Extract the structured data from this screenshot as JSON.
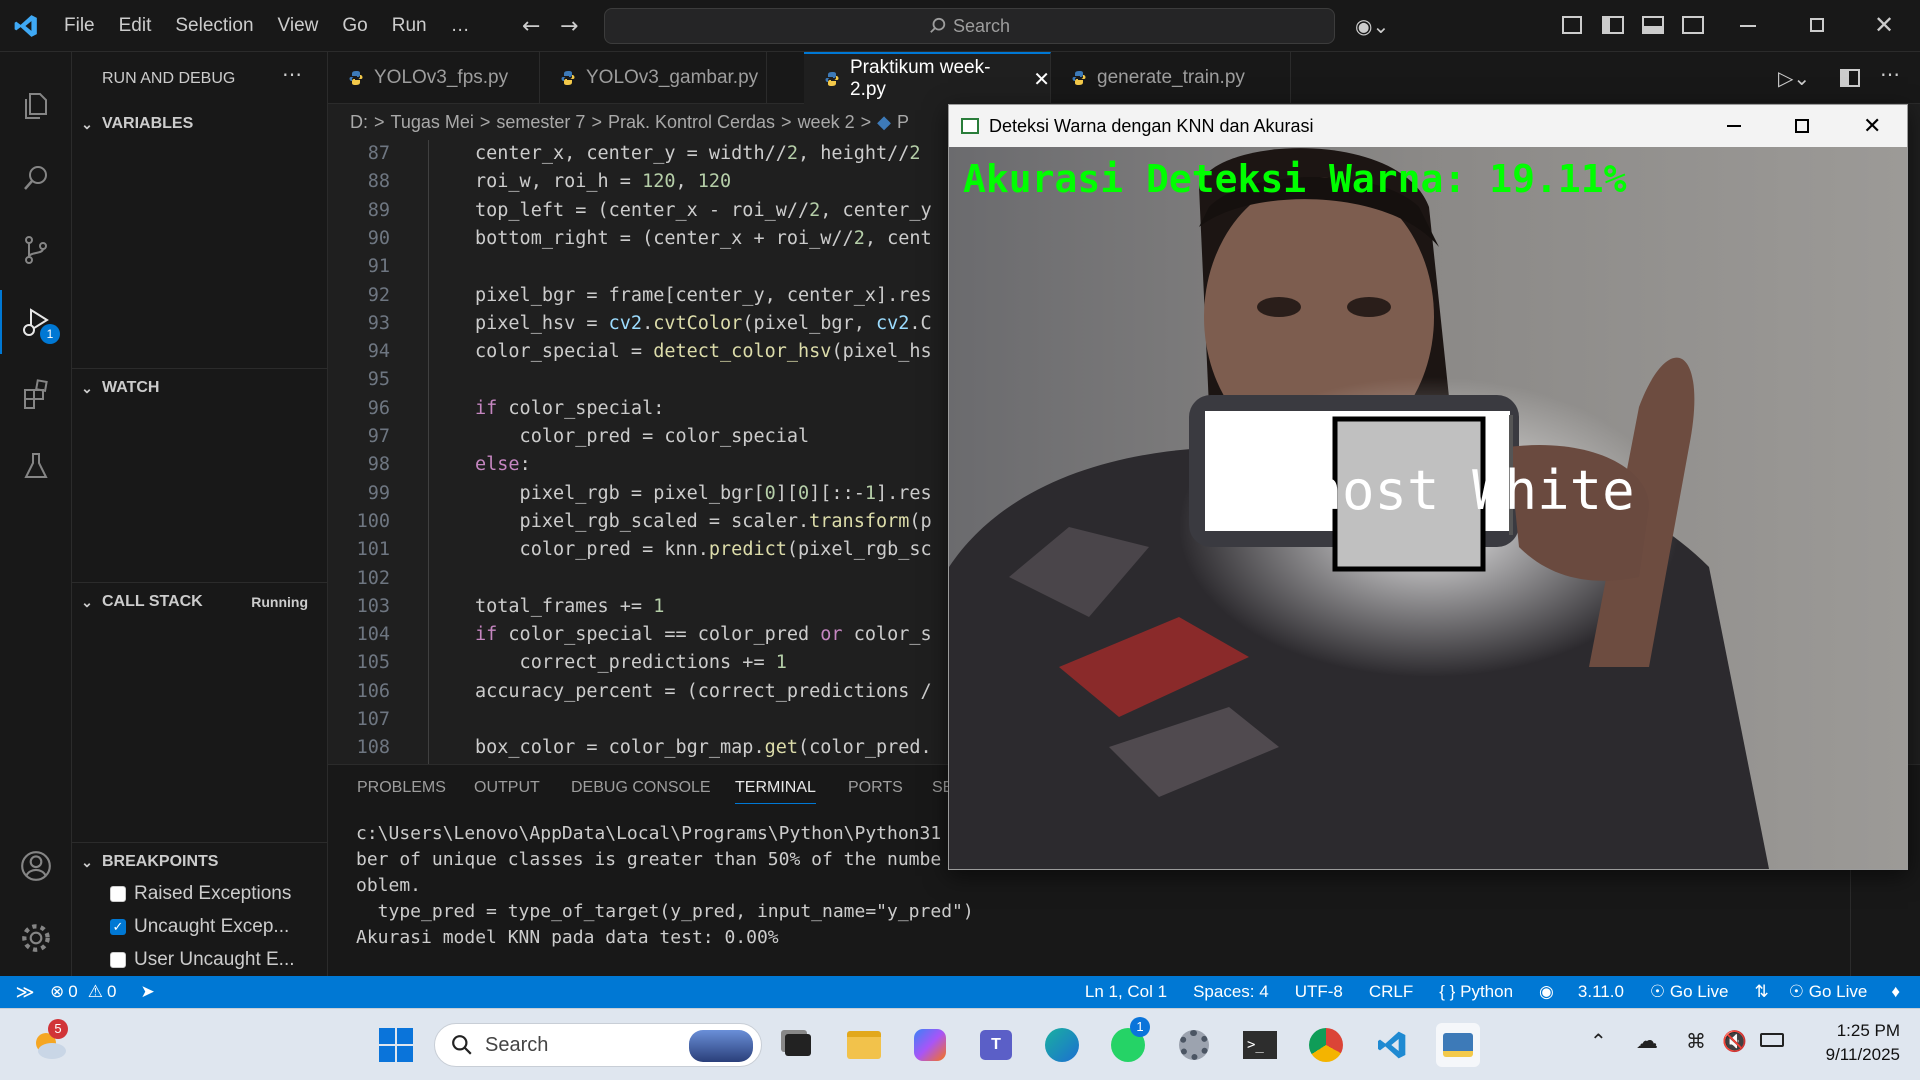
{
  "menu": [
    "File",
    "Edit",
    "Selection",
    "View",
    "Go",
    "Run",
    "…"
  ],
  "search": {
    "label": "Search"
  },
  "sidebar": {
    "title": "RUN AND DEBUG",
    "variables": "VARIABLES",
    "watch": "WATCH",
    "call_stack": "CALL STACK",
    "call_stack_status": "Running",
    "breakpoints": "BREAKPOINTS",
    "bp_items": [
      {
        "label": "Raised Exceptions",
        "checked": false
      },
      {
        "label": "Uncaught Excep...",
        "checked": true
      },
      {
        "label": "User Uncaught E...",
        "checked": false
      }
    ]
  },
  "activity": {
    "debug_badge": "1"
  },
  "tabs": [
    {
      "label": "YOLOv3_fps.py",
      "active": false
    },
    {
      "label": "YOLOv3_gambar.py",
      "active": false
    },
    {
      "label": "Praktikum week-2.py",
      "active": true
    },
    {
      "label": "generate_train.py",
      "active": false
    }
  ],
  "breadcrumb": [
    "D:",
    "Tugas Mei",
    "semester 7",
    "Prak. Kontrol Cerdas",
    "week 2",
    "P"
  ],
  "code": [
    {
      "n": "87",
      "t": "center_x, center_y = width//2, height//2"
    },
    {
      "n": "88",
      "t": "roi_w, roi_h = 120, 120"
    },
    {
      "n": "89",
      "t": "top_left = (center_x - roi_w//2, center_y"
    },
    {
      "n": "90",
      "t": "bottom_right = (center_x + roi_w//2, cent"
    },
    {
      "n": "91",
      "t": ""
    },
    {
      "n": "92",
      "t": "pixel_bgr = frame[center_y, center_x].res"
    },
    {
      "n": "93",
      "t": "pixel_hsv = cv2.cvtColor(pixel_bgr, cv2.C"
    },
    {
      "n": "94",
      "t": "color_special = detect_color_hsv(pixel_hs"
    },
    {
      "n": "95",
      "t": ""
    },
    {
      "n": "96",
      "t": "if color_special:"
    },
    {
      "n": "97",
      "t": "    color_pred = color_special"
    },
    {
      "n": "98",
      "t": "else:"
    },
    {
      "n": "99",
      "t": "    pixel_rgb = pixel_bgr[0][0][::-1].res"
    },
    {
      "n": "100",
      "t": "    pixel_rgb_scaled = scaler.transform(p"
    },
    {
      "n": "101",
      "t": "    color_pred = knn.predict(pixel_rgb_sc"
    },
    {
      "n": "102",
      "t": ""
    },
    {
      "n": "103",
      "t": "total_frames += 1"
    },
    {
      "n": "104",
      "t": "if color_special == color_pred or color_s"
    },
    {
      "n": "105",
      "t": "    correct_predictions += 1"
    },
    {
      "n": "106",
      "t": "accuracy_percent = (correct_predictions /"
    },
    {
      "n": "107",
      "t": ""
    },
    {
      "n": "108",
      "t": "box_color = color_bgr_map.get(color_pred."
    }
  ],
  "panel": {
    "tabs": [
      "PROBLEMS",
      "OUTPUT",
      "DEBUG CONSOLE",
      "TERMINAL",
      "PORTS",
      "SE"
    ],
    "terminal": [
      "c:\\Users\\Lenovo\\AppData\\Local\\Programs\\Python\\Python31",
      "ber of unique classes is greater than 50% of the numbe",
      "oblem.",
      "  type_pred = type_of_target(y_pred, input_name=\"y_pred\")",
      "Akurasi model KNN pada data test: 0.00%"
    ]
  },
  "status": {
    "errors": "0",
    "warnings": "0",
    "position": "Ln 1, Col 1",
    "spaces": "Spaces: 4",
    "encoding": "UTF-8",
    "eol": "CRLF",
    "language": "Python",
    "python_version": "3.11.0",
    "go_live_1": "Go Live",
    "go_live_2": "Go Live"
  },
  "cv_window": {
    "title": "Deteksi Warna dengan KNN dan Akurasi",
    "accuracy_text": "Akurasi Deteksi Warna: 19.11%",
    "color_label": "Ghost White",
    "accent": "#00ff00"
  },
  "taskbar": {
    "weather_badge": "5",
    "search": "Search",
    "whatsapp_badge": "1",
    "time": "1:25 PM",
    "date": "9/11/2025"
  },
  "colors": {
    "accent": "#0078d4",
    "editor_bg": "#1f1f1f",
    "chrome_bg": "#181818"
  }
}
